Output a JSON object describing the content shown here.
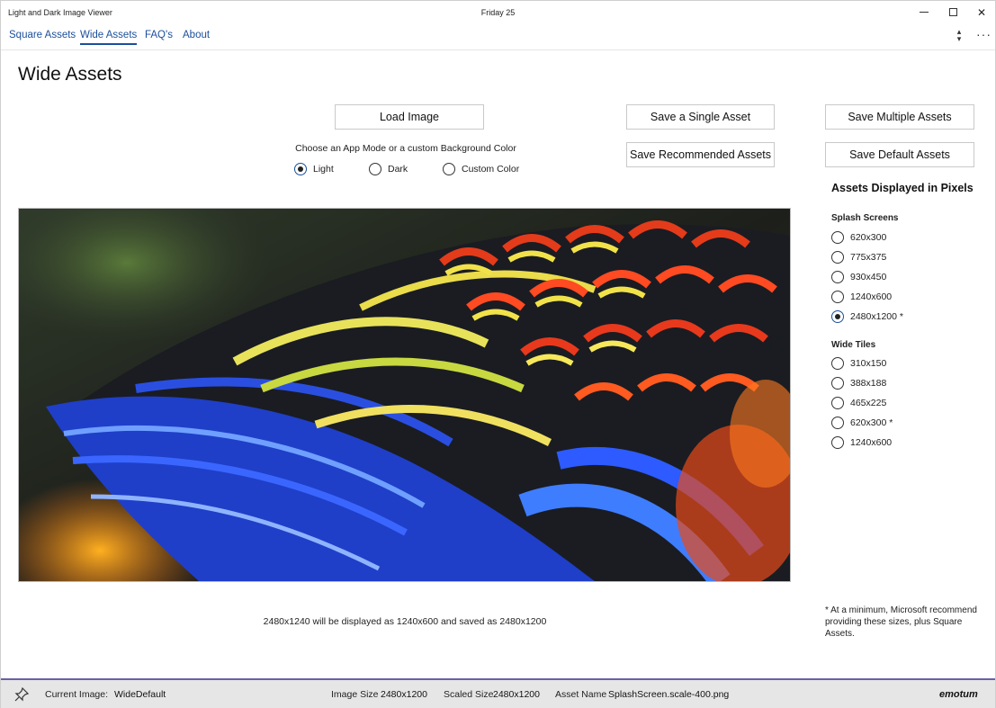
{
  "window": {
    "title": "Light and Dark Image Viewer",
    "date": "Friday 25"
  },
  "nav": {
    "items": [
      {
        "label": "Square Assets",
        "active": false
      },
      {
        "label": "Wide Assets",
        "active": true
      },
      {
        "label": "FAQ's",
        "active": false
      },
      {
        "label": "About",
        "active": false
      }
    ],
    "more_label": "···"
  },
  "page": {
    "title": "Wide Assets"
  },
  "buttons": {
    "load_image": "Load Image",
    "save_single": "Save a Single Asset",
    "save_multiple": "Save Multiple Assets",
    "save_recommended": "Save Recommended Assets",
    "save_default": "Save Default Assets"
  },
  "mode": {
    "caption": "Choose an App Mode or a custom Background Color",
    "options": [
      {
        "label": "Light",
        "selected": true
      },
      {
        "label": "Dark",
        "selected": false
      },
      {
        "label": "Custom Color",
        "selected": false
      }
    ]
  },
  "sizes": {
    "title": "Assets Displayed in Pixels",
    "splash_title": "Splash Screens",
    "splash": [
      {
        "label": "620x300",
        "selected": false
      },
      {
        "label": "775x375",
        "selected": false
      },
      {
        "label": "930x450",
        "selected": false
      },
      {
        "label": "1240x600",
        "selected": false
      },
      {
        "label": "2480x1200 *",
        "selected": true
      }
    ],
    "tiles_title": "Wide Tiles",
    "tiles": [
      {
        "label": "310x150",
        "selected": false
      },
      {
        "label": "388x188",
        "selected": false
      },
      {
        "label": "465x225",
        "selected": false
      },
      {
        "label": "620x300 *",
        "selected": false
      },
      {
        "label": "1240x600",
        "selected": false
      }
    ]
  },
  "preview": {
    "caption": "2480x1240 will be displayed as 1240x600 and saved as 2480x1200"
  },
  "footnote": "* At a minimum, Microsoft recommend providing these sizes, plus Square Assets.",
  "status": {
    "current_image_label": "Current Image:",
    "current_image_value": "WideDefault",
    "image_size_label": "Image Size",
    "image_size_value": "2480x1200",
    "scaled_size_label": "Scaled Size",
    "scaled_size_value": "2480x1200",
    "asset_name_label": "Asset Name",
    "asset_name_value": "SplashScreen.scale-400.png",
    "brand": "emotum"
  },
  "colors": {
    "accent": "#1b4f9c",
    "status_border": "#6b5fa7",
    "status_bg": "#e6e6e6"
  },
  "icons": {
    "pin": "pin-icon",
    "sort": "sort-icon",
    "more": "more-icon",
    "minimize": "minimize-icon",
    "maximize": "maximize-icon",
    "close": "close-icon"
  }
}
